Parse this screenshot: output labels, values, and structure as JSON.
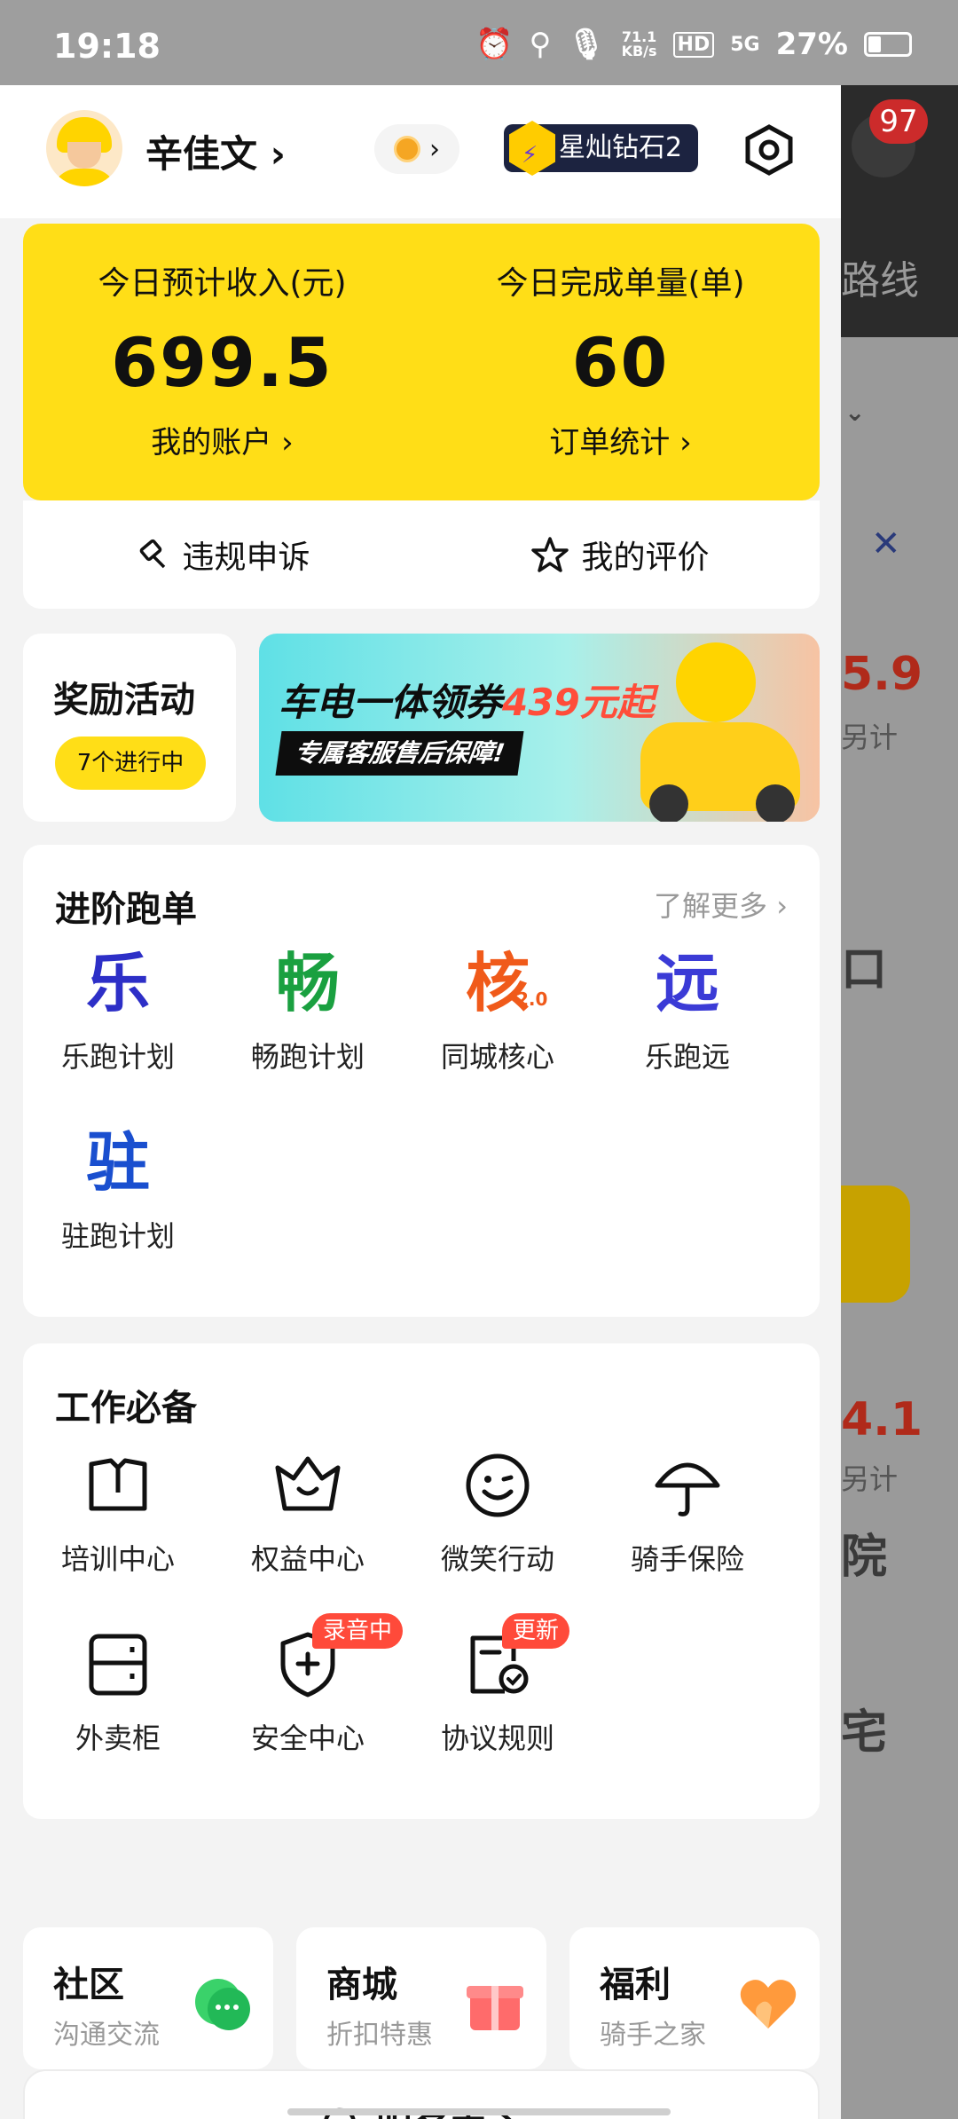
{
  "status_bar": {
    "time": "19:18",
    "net_speed_value": "71.1",
    "net_speed_unit": "KB/s",
    "hd": "HD",
    "signal": "5G",
    "battery": "27%"
  },
  "background_app": {
    "notification_count": "97",
    "text_route": "路线",
    "text_price1": "5.9",
    "text_sub1": "另计",
    "text_price2": "4.1",
    "text_sub2": "另计",
    "text_fragment1": "院",
    "text_fragment2": "宅",
    "text_fragment3": "口"
  },
  "header": {
    "user_name": "辛佳文",
    "vip_badge": "星灿钻石2"
  },
  "earnings": {
    "income_label": "今日预计收入(元)",
    "income_value": "699.5",
    "income_link": "我的账户",
    "orders_label": "今日完成单量(单)",
    "orders_value": "60",
    "orders_link": "订单统计"
  },
  "quick_links": {
    "appeal": "违规申诉",
    "rating": "我的评价"
  },
  "rewards": {
    "title": "奖励活动",
    "badge": "7个进行中"
  },
  "banner": {
    "headline_prefix": "车电一体领券",
    "headline_highlight": "439元起",
    "subline": "专属客服售后保障!"
  },
  "advanced": {
    "title": "进阶跑单",
    "more": "了解更多",
    "items": [
      {
        "glyph": "乐",
        "label": "乐跑计划",
        "color": "#2d2fc7"
      },
      {
        "glyph": "畅",
        "label": "畅跑计划",
        "color": "#1aa040"
      },
      {
        "glyph": "核",
        "label": "同城核心",
        "color": "#f05a1a"
      },
      {
        "glyph": "远",
        "label": "乐跑远",
        "color": "#3b3bd6"
      },
      {
        "glyph": "驻",
        "label": "驻跑计划",
        "color": "#1a4fcf"
      }
    ],
    "core_suffix": "2.0"
  },
  "essentials": {
    "title": "工作必备",
    "items": [
      {
        "label": "培训中心",
        "icon": "book-icon"
      },
      {
        "label": "权益中心",
        "icon": "crown-icon"
      },
      {
        "label": "微笑行动",
        "icon": "smile-icon"
      },
      {
        "label": "骑手保险",
        "icon": "umbrella-icon"
      },
      {
        "label": "外卖柜",
        "icon": "locker-icon"
      },
      {
        "label": "安全中心",
        "icon": "shield-icon",
        "tag": "录音中"
      },
      {
        "label": "协议规则",
        "icon": "agreement-icon",
        "tag": "更新"
      }
    ]
  },
  "mini_cards": [
    {
      "title": "社区",
      "subtitle": "沟通交流"
    },
    {
      "title": "商城",
      "subtitle": "折扣特惠"
    },
    {
      "title": "福利",
      "subtitle": "骑手之家"
    }
  ],
  "service": {
    "label": "服务中心"
  }
}
